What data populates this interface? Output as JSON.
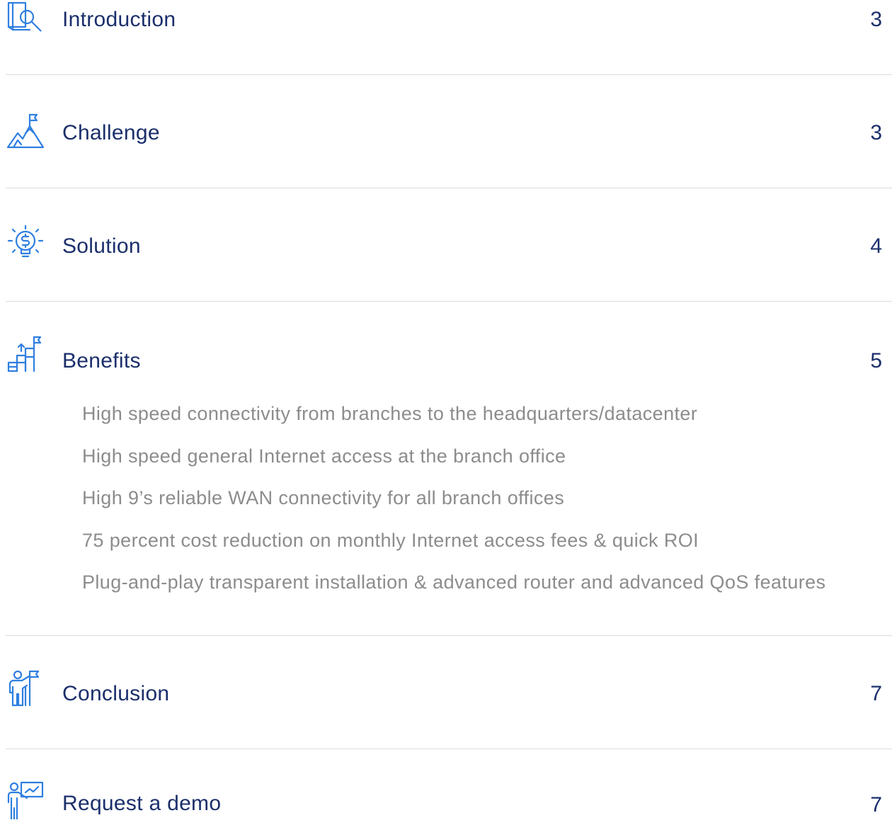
{
  "toc": {
    "intro": {
      "title": "Introduction",
      "page": "3",
      "icon": "book-magnifier-icon"
    },
    "challenge": {
      "title": "Challenge",
      "page": "3",
      "icon": "mountain-flag-icon"
    },
    "solution": {
      "title": "Solution",
      "page": "4",
      "icon": "lightbulb-dollar-icon"
    },
    "benefits": {
      "title": "Benefits",
      "page": "5",
      "icon": "stairs-flag-icon",
      "items": [
        "High speed connectivity from branches to the headquarters/datacenter",
        "High speed general Internet access at the branch office",
        "High 9’s reliable WAN connectivity for all branch offices",
        "75 percent cost reduction on monthly Internet access fees & quick ROI",
        "Plug-and-play transparent installation & advanced router and advanced QoS features"
      ]
    },
    "conclusion": {
      "title": "Conclusion",
      "page": "7",
      "icon": "person-flag-icon"
    },
    "demo": {
      "title": "Request a demo",
      "page": "7",
      "icon": "presenter-board-icon"
    }
  },
  "colors": {
    "title": "#1b2f6b",
    "icon": "#2f7fe0",
    "subitem": "#8c8c8c",
    "divider": "#dcdcdc"
  }
}
